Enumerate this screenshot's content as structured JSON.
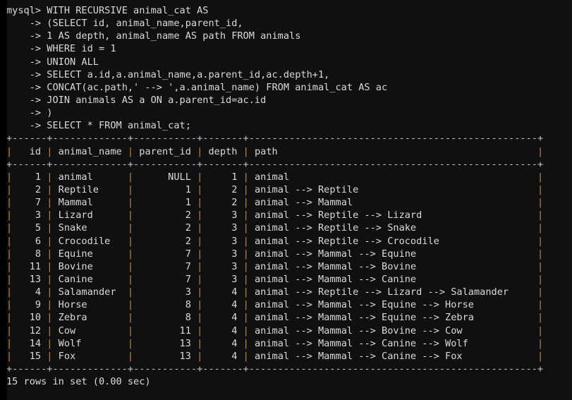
{
  "terminal": {
    "prompt": "mysql> ",
    "continuation": "    -> ",
    "colors": {
      "background": "#101010",
      "gutter": "#000000",
      "text": "#dadada",
      "rule": "#b9c3cf",
      "pipe": "#c08a4a"
    }
  },
  "query": {
    "first_line": "WITH RECURSIVE animal_cat AS",
    "continuation_lines": [
      "(SELECT id, animal_name,parent_id,",
      "1 AS depth, animal_name AS path FROM animals",
      "WHERE id = 1",
      "UNION ALL",
      "SELECT a.id,a.animal_name,a.parent_id,ac.depth+1,",
      "CONCAT(ac.path,' --> ',a.animal_name) FROM animal_cat AS ac",
      "JOIN animals AS a ON a.parent_id=ac.id",
      ")",
      "SELECT * FROM animal_cat;"
    ]
  },
  "result_table": {
    "rule": "+------+------------+-----------+-------+--------------------------------------------------+",
    "header_line": "| id   | animal_name | parent_id | depth | path                                             |",
    "columns": [
      "id",
      "animal_name",
      "parent_id",
      "depth",
      "path"
    ],
    "rows": [
      {
        "id": "1",
        "animal_name": "animal",
        "parent_id": "NULL",
        "depth": "1",
        "path": "animal"
      },
      {
        "id": "2",
        "animal_name": "Reptile",
        "parent_id": "1",
        "depth": "2",
        "path": "animal --> Reptile"
      },
      {
        "id": "7",
        "animal_name": "Mammal",
        "parent_id": "1",
        "depth": "2",
        "path": "animal --> Mammal"
      },
      {
        "id": "3",
        "animal_name": "Lizard",
        "parent_id": "2",
        "depth": "3",
        "path": "animal --> Reptile --> Lizard"
      },
      {
        "id": "5",
        "animal_name": "Snake",
        "parent_id": "2",
        "depth": "3",
        "path": "animal --> Reptile --> Snake"
      },
      {
        "id": "6",
        "animal_name": "Crocodile",
        "parent_id": "2",
        "depth": "3",
        "path": "animal --> Reptile --> Crocodile"
      },
      {
        "id": "8",
        "animal_name": "Equine",
        "parent_id": "7",
        "depth": "3",
        "path": "animal --> Mammal --> Equine"
      },
      {
        "id": "11",
        "animal_name": "Bovine",
        "parent_id": "7",
        "depth": "3",
        "path": "animal --> Mammal --> Bovine"
      },
      {
        "id": "13",
        "animal_name": "Canine",
        "parent_id": "7",
        "depth": "3",
        "path": "animal --> Mammal --> Canine"
      },
      {
        "id": "4",
        "animal_name": "Salamander",
        "parent_id": "3",
        "depth": "4",
        "path": "animal --> Reptile --> Lizard --> Salamander"
      },
      {
        "id": "9",
        "animal_name": "Horse",
        "parent_id": "8",
        "depth": "4",
        "path": "animal --> Mammal --> Equine --> Horse"
      },
      {
        "id": "10",
        "animal_name": "Zebra",
        "parent_id": "8",
        "depth": "4",
        "path": "animal --> Mammal --> Equine --> Zebra"
      },
      {
        "id": "12",
        "animal_name": "Cow",
        "parent_id": "11",
        "depth": "4",
        "path": "animal --> Mammal --> Bovine --> Cow"
      },
      {
        "id": "14",
        "animal_name": "Wolf",
        "parent_id": "13",
        "depth": "4",
        "path": "animal --> Mammal --> Canine --> Wolf"
      },
      {
        "id": "15",
        "animal_name": "Fox",
        "parent_id": "13",
        "depth": "4",
        "path": "animal --> Mammal --> Canine --> Fox"
      }
    ]
  },
  "status": {
    "row_count_line": "15 rows in set (0.00 sec)"
  }
}
